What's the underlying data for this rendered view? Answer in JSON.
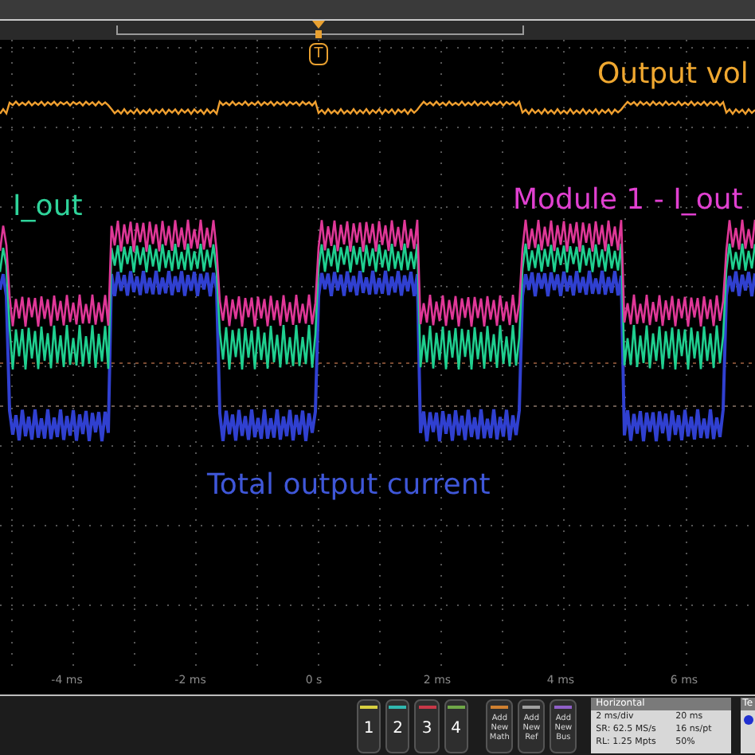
{
  "trigger_marker": {
    "label": "T"
  },
  "trace_labels": [
    {
      "kind": "voltage",
      "text": "Output vol",
      "color": "#f0a830"
    },
    {
      "kind": "green",
      "text": "I_out",
      "color": "#2fd39a"
    },
    {
      "kind": "pink",
      "text": "Module 1 - I_out",
      "color": "#e040d0"
    },
    {
      "kind": "blue",
      "text": "Total output current",
      "color": "#3f57d8"
    }
  ],
  "time_axis": [
    "-4 ms",
    "-2 ms",
    "0 s",
    "2 ms",
    "4 ms",
    "6 ms"
  ],
  "channel_buttons": [
    {
      "label": "1",
      "color": "#d8d040"
    },
    {
      "label": "2",
      "color": "#30b8b0"
    },
    {
      "label": "3",
      "color": "#c83848"
    },
    {
      "label": "4",
      "color": "#70a848"
    }
  ],
  "add_buttons": [
    {
      "label": "Add New Math",
      "color": "#d08030"
    },
    {
      "label": "Add New Ref",
      "color": "#a0a0a0"
    },
    {
      "label": "Add New Bus",
      "color": "#9060c8"
    }
  ],
  "horizontal": {
    "title": "Horizontal",
    "rows": [
      [
        "2 ms/div",
        "20 ms"
      ],
      [
        "SR: 62.5 MS/s",
        "16 ns/pt"
      ],
      [
        "RL: 1.25 Mpts",
        "50%"
      ]
    ]
  },
  "cut_panel": {
    "title": "Te"
  }
}
